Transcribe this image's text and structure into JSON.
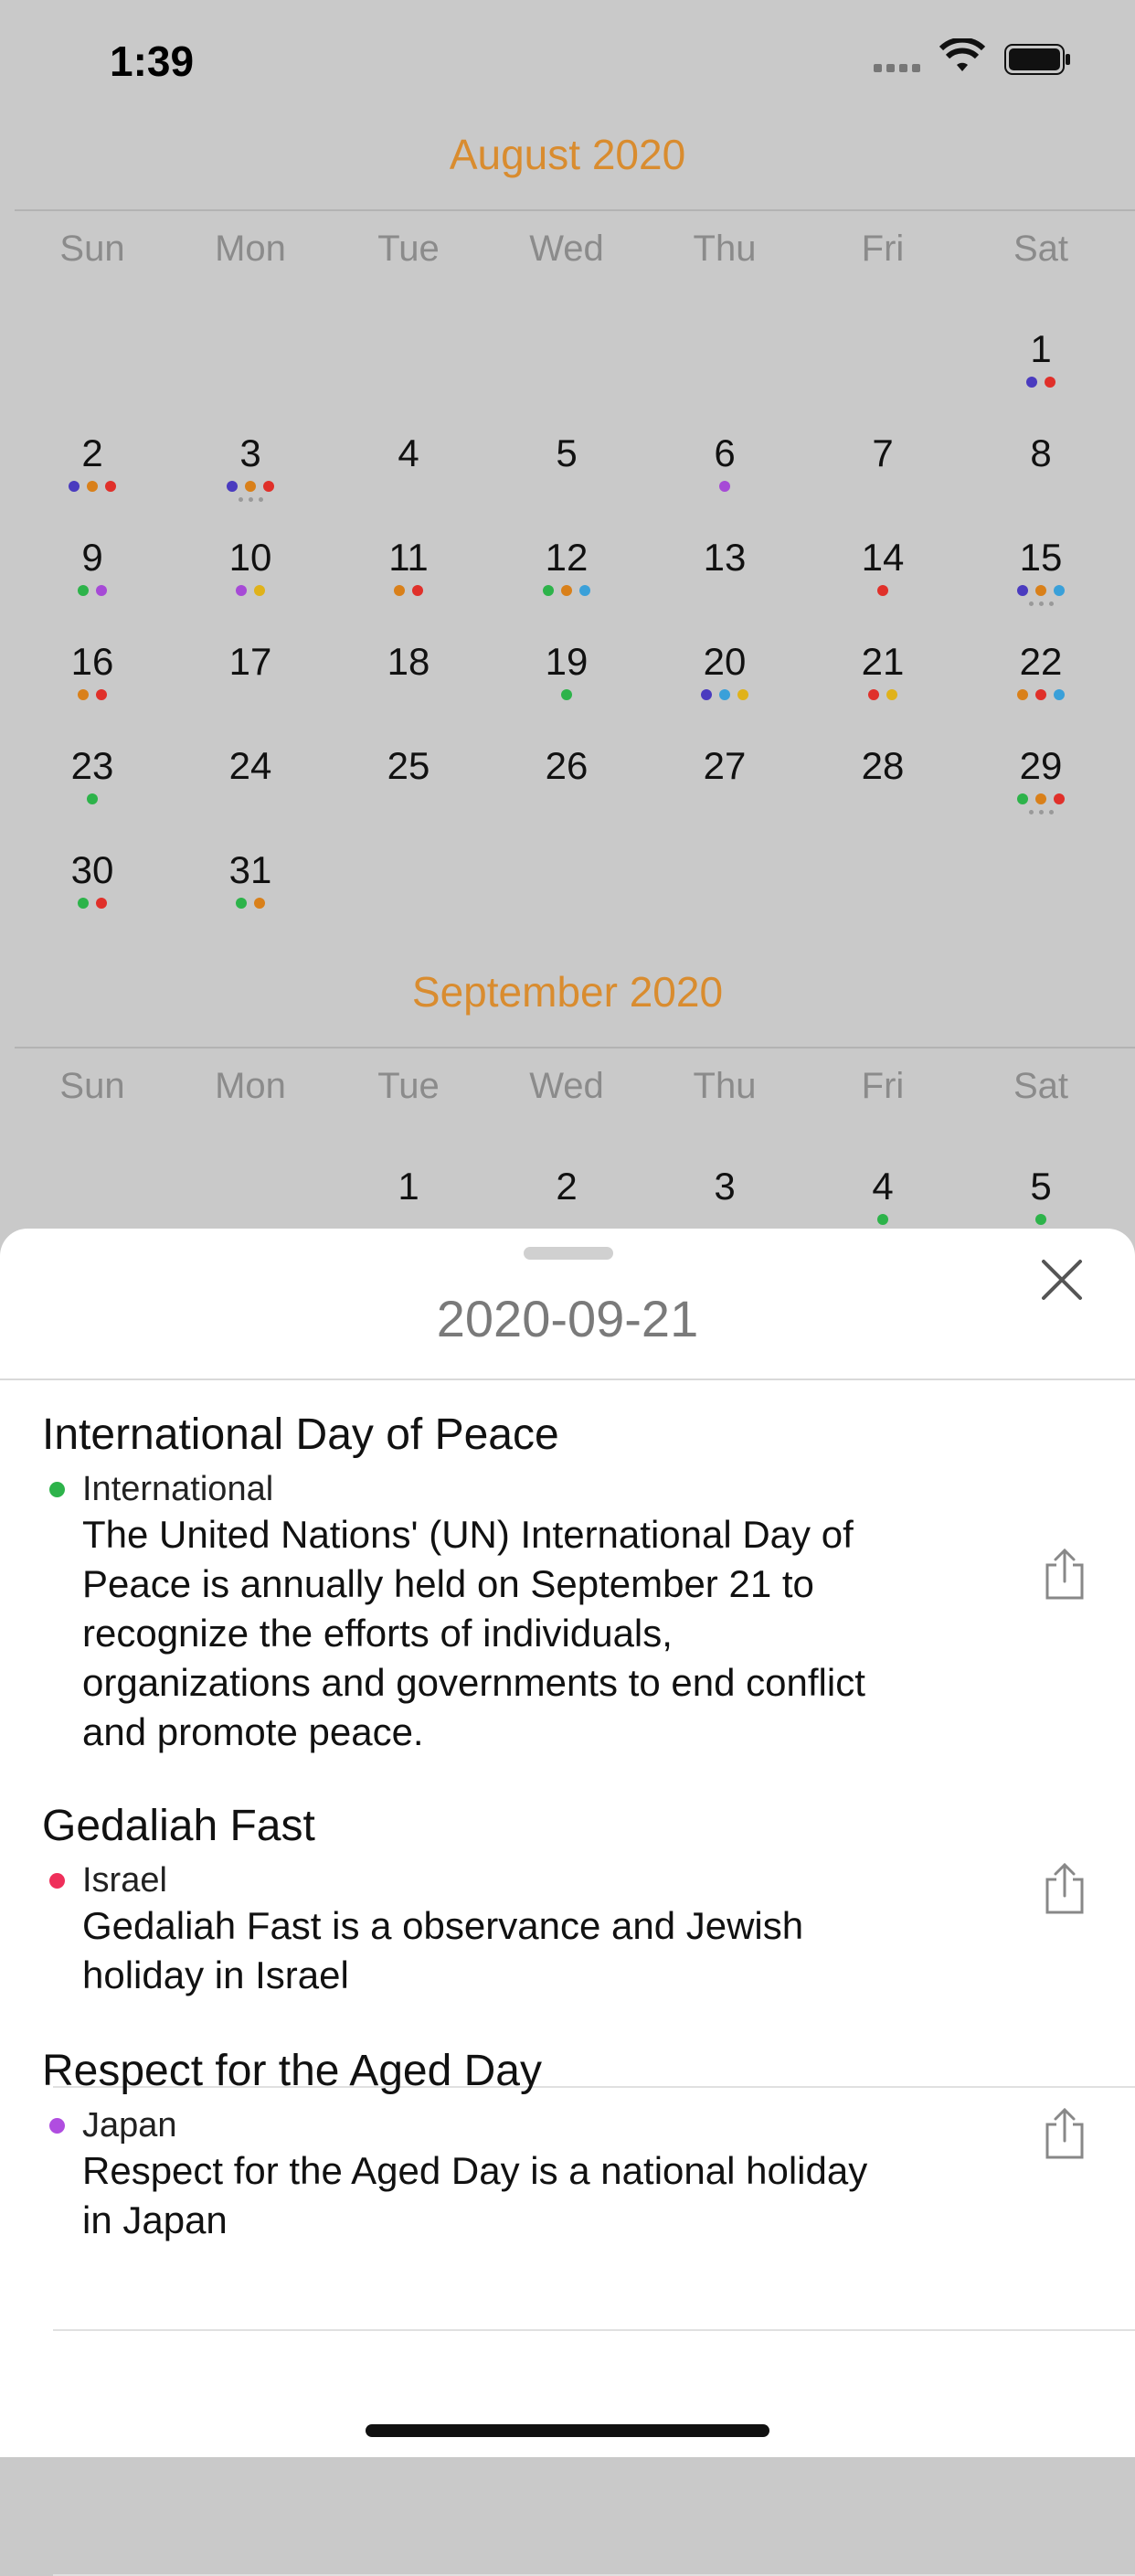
{
  "status": {
    "time": "1:39"
  },
  "colors": {
    "accent": "#d98c2f",
    "green": "#2db34a",
    "orange": "#d9801a",
    "red": "#e0302a",
    "purple": "#a64ad6",
    "navy": "#4a3bbf",
    "yellow": "#e0b21a",
    "blue": "#3aa0d9"
  },
  "calendar": {
    "weekdays": [
      "Sun",
      "Mon",
      "Tue",
      "Wed",
      "Thu",
      "Fri",
      "Sat"
    ],
    "months": [
      {
        "title": "August 2020"
      },
      {
        "title": "September 2020"
      }
    ]
  },
  "sheet": {
    "date_title": "2020-09-21",
    "events": [
      {
        "title": "International Day of Peace",
        "country": "International",
        "color": "#2db34a",
        "desc_lines": [
          "The United Nations' (UN) International Day of",
          "Peace is annually held on September 21 to",
          "recognize the efforts of individuals,",
          "organizations and governments to end conflict",
          "and promote peace."
        ]
      },
      {
        "title": "Gedaliah Fast",
        "country": "Israel",
        "color": "#ef2f5a",
        "desc_lines": [
          "Gedaliah Fast is a observance and Jewish",
          "holiday in Israel"
        ]
      },
      {
        "title": "Respect for the Aged Day",
        "country": "Japan",
        "color": "#b04de0",
        "desc_lines": [
          "Respect for the Aged Day is a national holiday",
          "in Japan"
        ]
      }
    ]
  },
  "aug_days": [
    {
      "n": "1",
      "col": 6,
      "row": 0,
      "dots": [
        "#4a3bbf",
        "#e0302a"
      ]
    },
    {
      "n": "2",
      "col": 0,
      "row": 1,
      "dots": [
        "#4a3bbf",
        "#d9801a",
        "#e0302a"
      ]
    },
    {
      "n": "3",
      "col": 1,
      "row": 1,
      "dots": [
        "#4a3bbf",
        "#d9801a",
        "#e0302a"
      ],
      "more": true
    },
    {
      "n": "4",
      "col": 2,
      "row": 1,
      "dots": []
    },
    {
      "n": "5",
      "col": 3,
      "row": 1,
      "dots": []
    },
    {
      "n": "6",
      "col": 4,
      "row": 1,
      "dots": [
        "#a64ad6"
      ]
    },
    {
      "n": "7",
      "col": 5,
      "row": 1,
      "dots": []
    },
    {
      "n": "8",
      "col": 6,
      "row": 1,
      "dots": []
    },
    {
      "n": "9",
      "col": 0,
      "row": 2,
      "dots": [
        "#2db34a",
        "#a64ad6"
      ]
    },
    {
      "n": "10",
      "col": 1,
      "row": 2,
      "dots": [
        "#a64ad6",
        "#e0b21a"
      ]
    },
    {
      "n": "11",
      "col": 2,
      "row": 2,
      "dots": [
        "#d9801a",
        "#e0302a"
      ]
    },
    {
      "n": "12",
      "col": 3,
      "row": 2,
      "dots": [
        "#2db34a",
        "#d9801a",
        "#3aa0d9"
      ]
    },
    {
      "n": "13",
      "col": 4,
      "row": 2,
      "dots": []
    },
    {
      "n": "14",
      "col": 5,
      "row": 2,
      "dots": [
        "#e0302a"
      ]
    },
    {
      "n": "15",
      "col": 6,
      "row": 2,
      "dots": [
        "#4a3bbf",
        "#d9801a",
        "#3aa0d9"
      ],
      "more": true
    },
    {
      "n": "16",
      "col": 0,
      "row": 3,
      "dots": [
        "#d9801a",
        "#e0302a"
      ]
    },
    {
      "n": "17",
      "col": 1,
      "row": 3,
      "dots": []
    },
    {
      "n": "18",
      "col": 2,
      "row": 3,
      "dots": []
    },
    {
      "n": "19",
      "col": 3,
      "row": 3,
      "dots": [
        "#2db34a"
      ]
    },
    {
      "n": "20",
      "col": 4,
      "row": 3,
      "dots": [
        "#4a3bbf",
        "#3aa0d9",
        "#e0b21a"
      ]
    },
    {
      "n": "21",
      "col": 5,
      "row": 3,
      "dots": [
        "#e0302a",
        "#e0b21a"
      ]
    },
    {
      "n": "22",
      "col": 6,
      "row": 3,
      "dots": [
        "#d9801a",
        "#e0302a",
        "#3aa0d9"
      ]
    },
    {
      "n": "23",
      "col": 0,
      "row": 4,
      "dots": [
        "#2db34a"
      ]
    },
    {
      "n": "24",
      "col": 1,
      "row": 4,
      "dots": []
    },
    {
      "n": "25",
      "col": 2,
      "row": 4,
      "dots": []
    },
    {
      "n": "26",
      "col": 3,
      "row": 4,
      "dots": []
    },
    {
      "n": "27",
      "col": 4,
      "row": 4,
      "dots": []
    },
    {
      "n": "28",
      "col": 5,
      "row": 4,
      "dots": []
    },
    {
      "n": "29",
      "col": 6,
      "row": 4,
      "dots": [
        "#2db34a",
        "#d9801a",
        "#e0302a"
      ],
      "more": true
    },
    {
      "n": "30",
      "col": 0,
      "row": 5,
      "dots": [
        "#2db34a",
        "#e0302a"
      ]
    },
    {
      "n": "31",
      "col": 1,
      "row": 5,
      "dots": [
        "#2db34a",
        "#d9801a"
      ]
    }
  ],
  "sep_days": [
    {
      "n": "1",
      "col": 2,
      "row": 0,
      "dots": []
    },
    {
      "n": "2",
      "col": 3,
      "row": 0,
      "dots": []
    },
    {
      "n": "3",
      "col": 4,
      "row": 0,
      "dots": []
    },
    {
      "n": "4",
      "col": 5,
      "row": 0,
      "dots": [
        "#2db34a"
      ]
    },
    {
      "n": "5",
      "col": 6,
      "row": 0,
      "dots": [
        "#2db34a"
      ]
    }
  ]
}
